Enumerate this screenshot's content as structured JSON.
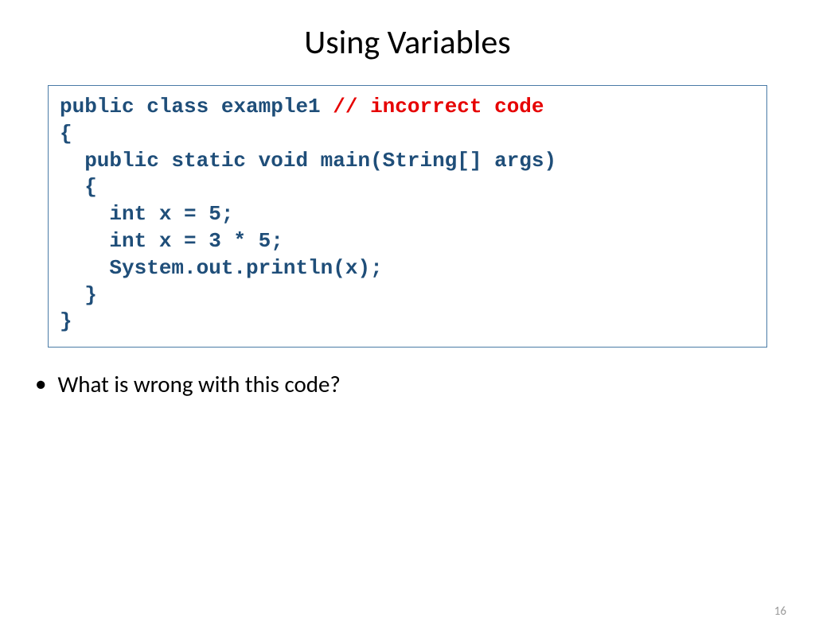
{
  "title": "Using Variables",
  "code": {
    "line1a": "public class example1 ",
    "line1b": "// incorrect code",
    "line2": "{",
    "line3": "  public static void main(String[] args)",
    "line4": "  {",
    "line5": "    int x = 5;",
    "line6": "    int x = 3 * 5;",
    "line7": "    System.out.println(x);",
    "line8": "  }",
    "line9": "}"
  },
  "bullet": {
    "dot": "•",
    "text": "What is wrong with this code?"
  },
  "pageNumber": "16"
}
